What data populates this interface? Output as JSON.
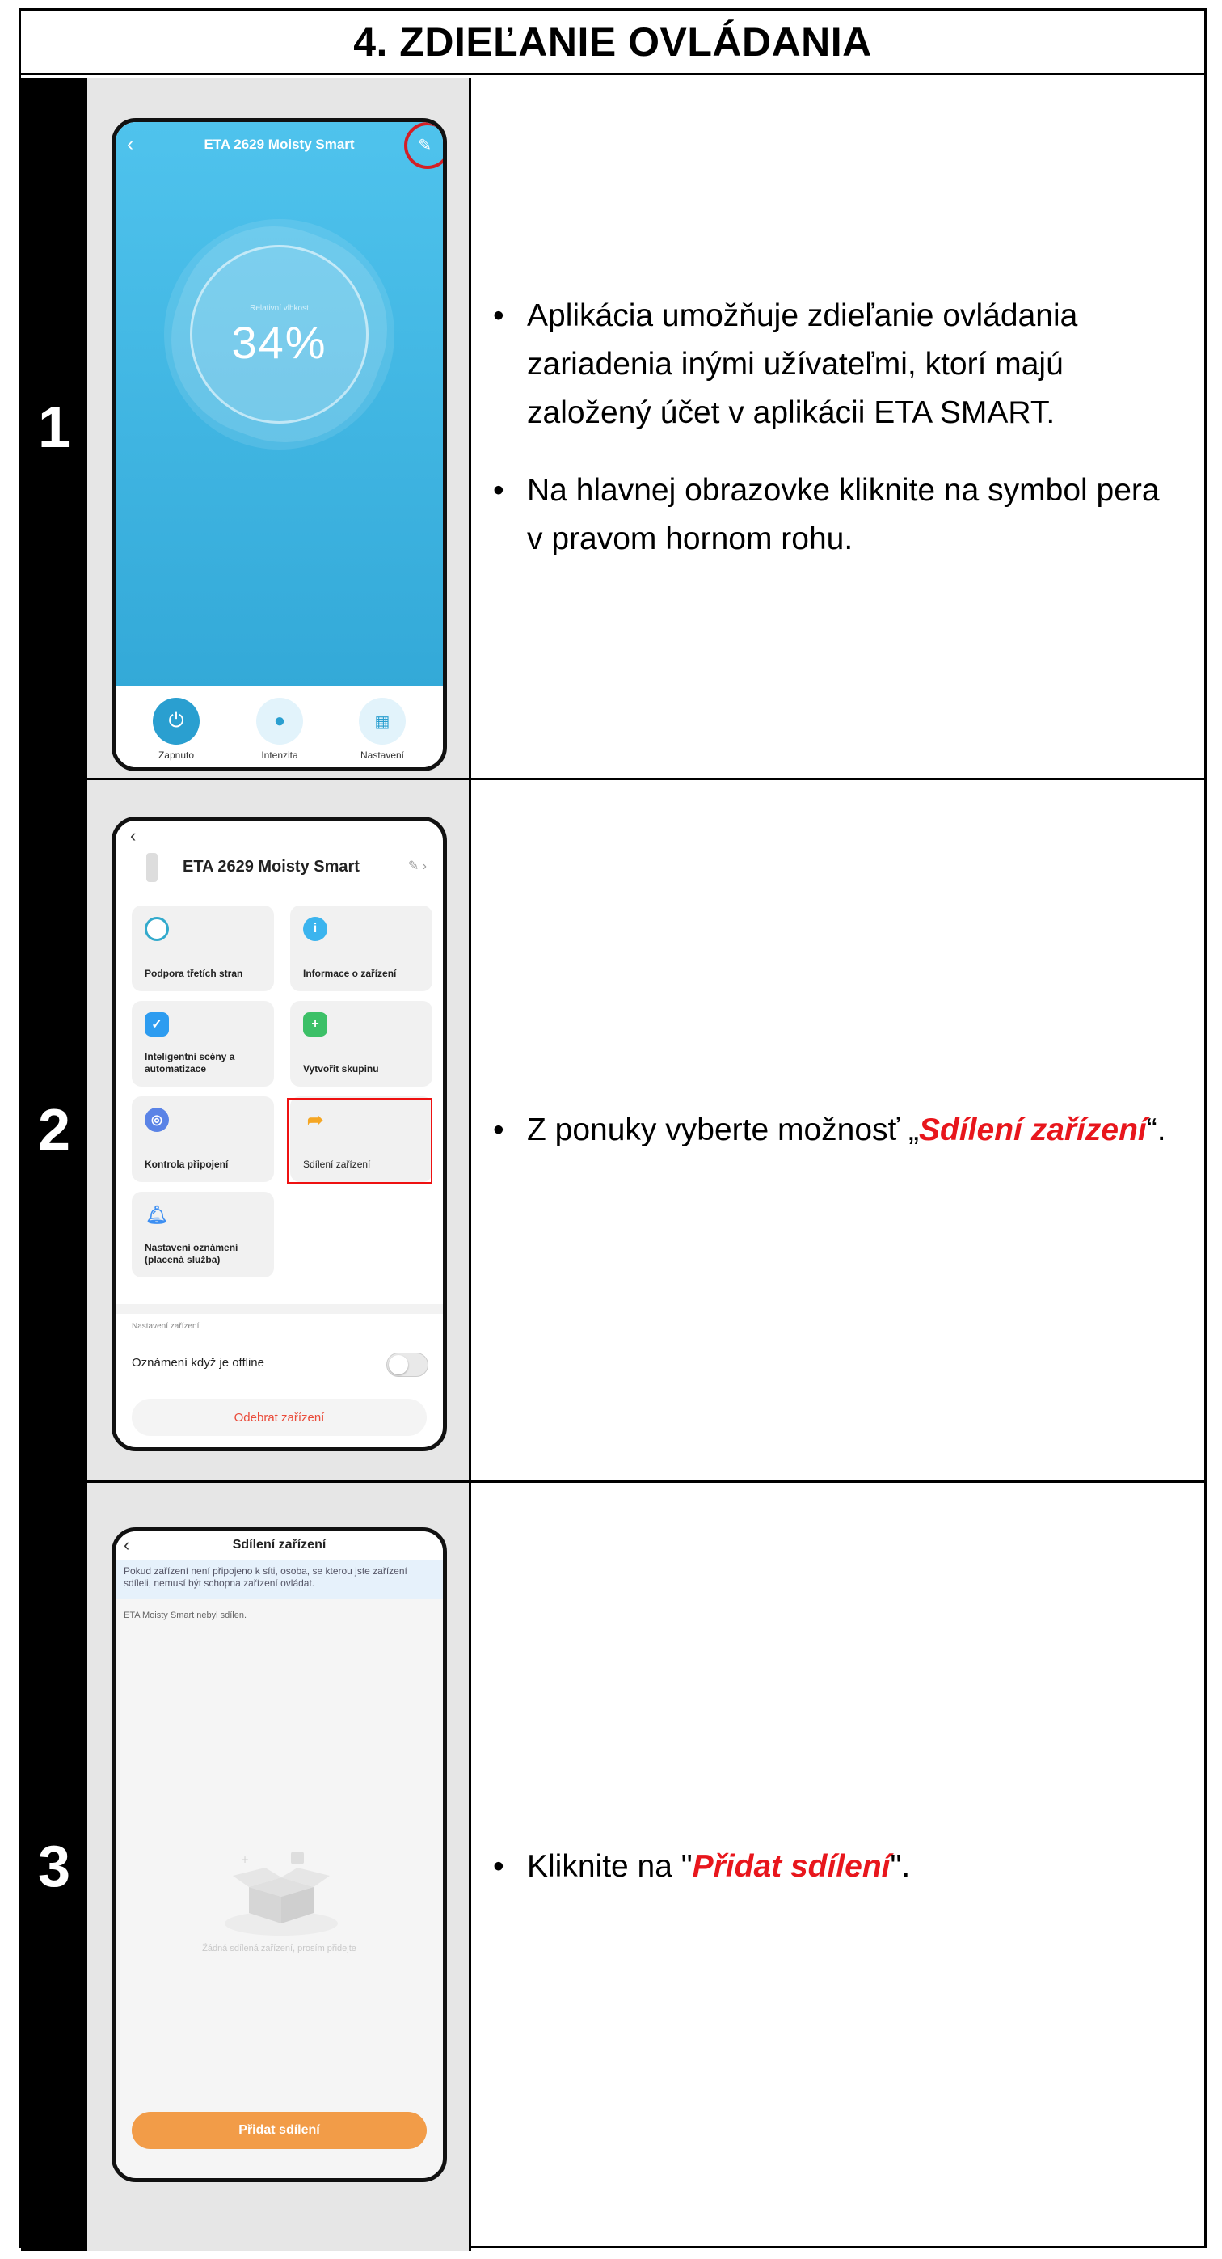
{
  "title": "4. ZDIEĽANIE OVLÁDANIA",
  "steps": [
    {
      "number": "1",
      "phone": {
        "device_name": "ETA 2629 Moisty Smart",
        "gauge_label": "Relativní vlhkost",
        "gauge_value": "34%",
        "buttons": [
          "Zapnuto",
          "Intenzita",
          "Nastavení"
        ]
      },
      "bullets": [
        "Aplikácia umožňuje zdieľanie ovládania zariadenia inými užívateľmi, ktorí majú založený účet v aplikácii ETA SMART.",
        "Na hlavnej obrazovke kliknite na symbol pera v pravom hornom rohu."
      ]
    },
    {
      "number": "2",
      "phone": {
        "device_name": "ETA 2629 Moisty Smart",
        "tiles": [
          "Podpora třetích stran",
          "Informace o zařízení",
          "Inteligentní scény a automatizace",
          "Vytvořit skupinu",
          "Kontrola připojení",
          "Sdílení zařízení",
          "Nastavení oznámení (placená služba)"
        ],
        "section_label": "Nastavení zařízení",
        "offline_label": "Oznámení když je offline",
        "remove_label": "Odebrat zařízení"
      },
      "bullet_prefix": "Z ponuky vyberte možnosť „",
      "bullet_emphasis": "Sdílení zařízení",
      "bullet_suffix": "“."
    },
    {
      "number": "3",
      "phone": {
        "title": "Sdílení zařízení",
        "notice": "Pokud zařízení není připojeno k síti, osoba, se kterou jste zařízení sdíleli, nemusí být schopna zařízení ovládat.",
        "status": "ETA Moisty Smart  nebyl sdílen.",
        "empty": "Žádná sdílená zařízení, prosím přidejte",
        "add_button": "Přidat sdílení"
      },
      "bullet_prefix": "Kliknite na \"",
      "bullet_emphasis": "Přidat sdílení",
      "bullet_suffix": "\"."
    }
  ],
  "colors": {
    "accent_red": "#e8161c",
    "phone1_bg": "#3db6e3",
    "orange_button": "#f29c48"
  }
}
